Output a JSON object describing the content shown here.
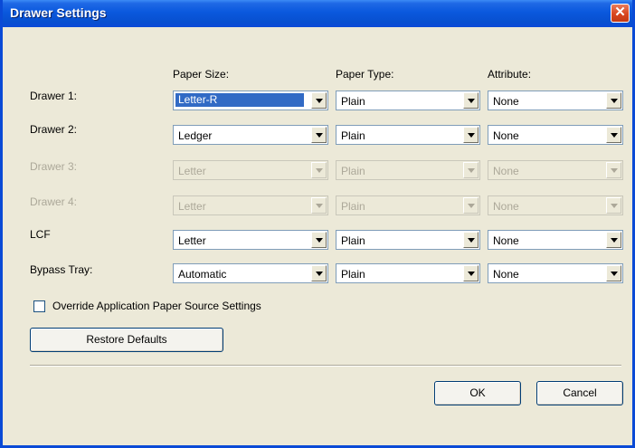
{
  "window": {
    "title": "Drawer Settings",
    "close_glyph": "✕"
  },
  "headers": {
    "paper_size": "Paper Size:",
    "paper_type": "Paper Type:",
    "attribute": "Attribute:"
  },
  "rows": [
    {
      "label": "Drawer 1:",
      "size": "Letter-R",
      "type": "Plain",
      "attribute": "None",
      "enabled": true,
      "size_focused": true
    },
    {
      "label": "Drawer 2:",
      "size": "Ledger",
      "type": "Plain",
      "attribute": "None",
      "enabled": true
    },
    {
      "label": "Drawer 3:",
      "size": "Letter",
      "type": "Plain",
      "attribute": "None",
      "enabled": false
    },
    {
      "label": "Drawer 4:",
      "size": "Letter",
      "type": "Plain",
      "attribute": "None",
      "enabled": false
    },
    {
      "label": "LCF",
      "size": "Letter",
      "type": "Plain",
      "attribute": "None",
      "enabled": true
    },
    {
      "label": "Bypass Tray:",
      "size": "Automatic",
      "type": "Plain",
      "attribute": "None",
      "enabled": true
    }
  ],
  "override": {
    "label": "Override Application Paper Source Settings",
    "checked": false
  },
  "buttons": {
    "restore": "Restore Defaults",
    "ok": "OK",
    "cancel": "Cancel"
  },
  "icons": {
    "close": "close-icon",
    "dropdown": "chevron-down-icon"
  },
  "colors": {
    "titlebar": "#0a58dd",
    "dialog_bg": "#ece9d8",
    "selection": "#316ac5",
    "close_button": "#d9461f"
  }
}
